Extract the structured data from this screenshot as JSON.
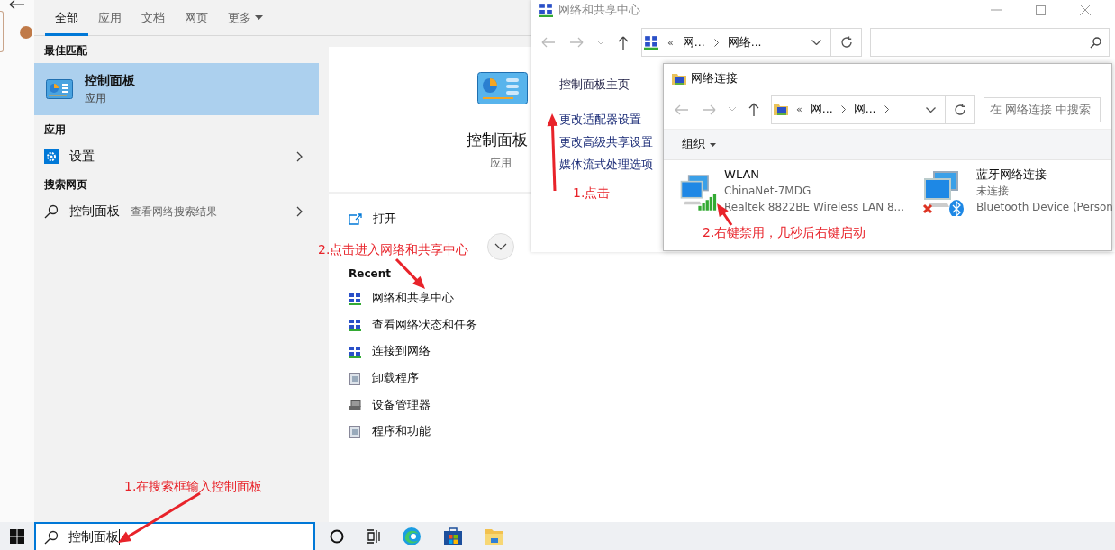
{
  "search_panel": {
    "tabs": [
      {
        "label": "全部",
        "selected": true,
        "has_menu": false
      },
      {
        "label": "应用",
        "selected": false,
        "has_menu": false
      },
      {
        "label": "文档",
        "selected": false,
        "has_menu": false
      },
      {
        "label": "网页",
        "selected": false,
        "has_menu": false
      },
      {
        "label": "更多",
        "selected": false,
        "has_menu": true
      }
    ],
    "best_match": {
      "heading": "最佳匹配",
      "title": "控制面板",
      "subtitle": "应用",
      "selected": true
    },
    "apps": {
      "heading": "应用",
      "items": [
        {
          "label": "设置"
        }
      ]
    },
    "web": {
      "heading": "搜索网页",
      "query": "控制面板",
      "suffix": " - 查看网络搜索结果"
    },
    "detail": {
      "title": "控制面板",
      "subtitle": "应用",
      "actions": [
        {
          "label": "打开"
        }
      ],
      "recent_heading": "Recent",
      "recent": [
        {
          "label": "网络和共享中心",
          "kind": "network"
        },
        {
          "label": "查看网络状态和任务",
          "kind": "network"
        },
        {
          "label": "连接到网络",
          "kind": "network"
        },
        {
          "label": "卸载程序",
          "kind": "program"
        },
        {
          "label": "设备管理器",
          "kind": "device"
        },
        {
          "label": "程序和功能",
          "kind": "program"
        }
      ]
    }
  },
  "taskbar": {
    "search_value": "控制面板"
  },
  "sharing_window": {
    "title": "网络和共享中心",
    "breadcrumb_lead": "«",
    "breadcrumb": [
      "网...",
      "网络..."
    ],
    "sidebar": [
      "控制面板主页",
      "更改适配器设置",
      "更改高级共享设置",
      "媒体流式处理选项"
    ]
  },
  "connections_window": {
    "title": "网络连接",
    "breadcrumb_lead": "«",
    "breadcrumb": [
      "网...",
      "网..."
    ],
    "search_placeholder": "在 网络连接 中搜索",
    "toolbar": [
      "组织"
    ],
    "adapters": [
      {
        "name": "WLAN",
        "status": "ChinaNet-7MDG",
        "device": "Realtek 8822BE Wireless LAN 8...",
        "kind": "wifi"
      },
      {
        "name": "蓝牙网络连接",
        "status": "未连接",
        "device": "Bluetooth Device (Person",
        "kind": "bluetooth"
      }
    ]
  },
  "annotations": [
    {
      "text": "1.点击"
    },
    {
      "text": "2.点击进入网络和共享中心"
    },
    {
      "text": "2.右键禁用，几秒后右键启动"
    },
    {
      "text": "1.在搜索框输入控制面板"
    }
  ]
}
